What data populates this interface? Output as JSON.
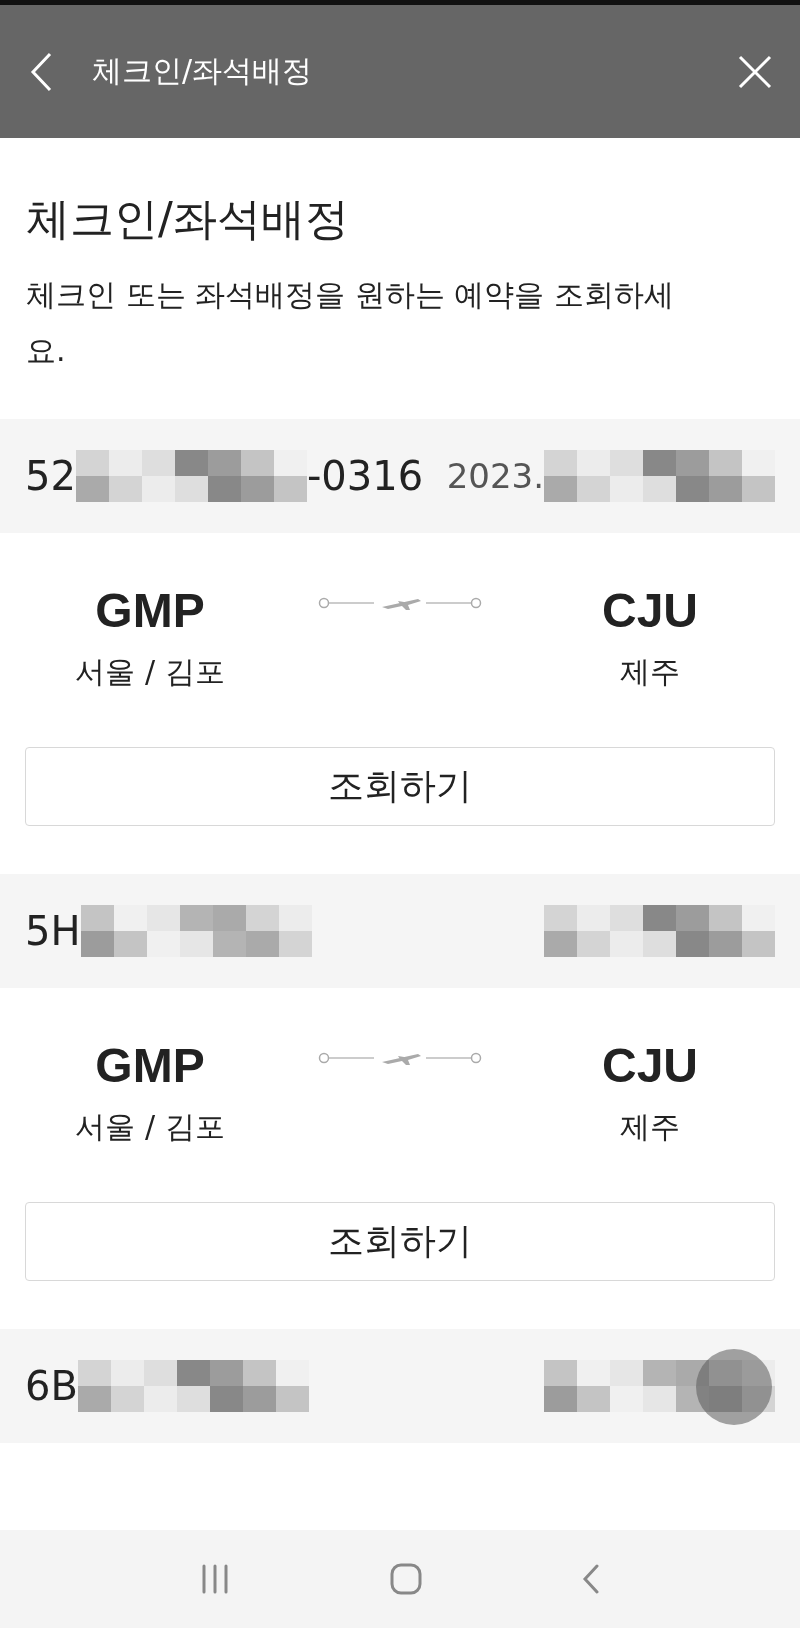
{
  "header": {
    "title": "체크인/좌석배정"
  },
  "page": {
    "title": "체크인/좌석배정",
    "description": "체크인 또는 좌석배정을 원하는 예약을 조회하세요."
  },
  "bookings": [
    {
      "left": [
        {
          "kind": "text",
          "text": "52"
        },
        {
          "kind": "mosaic"
        },
        {
          "kind": "text",
          "text": "-0316"
        }
      ],
      "right": [
        {
          "kind": "text",
          "text": "2023."
        },
        {
          "kind": "mosaic"
        }
      ],
      "origin": {
        "code": "GMP",
        "city": "서울 / 김포"
      },
      "destination": {
        "code": "CJU",
        "city": "제주"
      },
      "button": "조회하기"
    },
    {
      "left": [
        {
          "kind": "text",
          "text": "5H"
        },
        {
          "kind": "mosaic"
        }
      ],
      "right": [
        {
          "kind": "mosaic"
        }
      ],
      "origin": {
        "code": "GMP",
        "city": "서울 / 김포"
      },
      "destination": {
        "code": "CJU",
        "city": "제주"
      },
      "button": "조회하기"
    },
    {
      "left": [
        {
          "kind": "text",
          "text": "6B"
        },
        {
          "kind": "mosaic"
        }
      ],
      "right": [
        {
          "kind": "mosaic"
        }
      ]
    }
  ]
}
